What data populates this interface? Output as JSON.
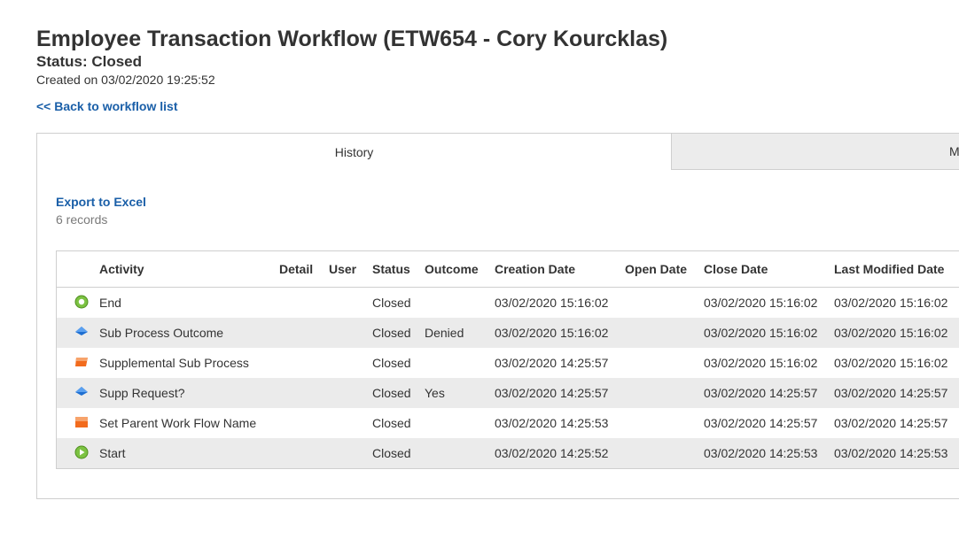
{
  "header": {
    "title": "Employee Transaction Workflow (ETW654 - Cory Kourcklas)",
    "status": "Status: Closed",
    "created": "Created on 03/02/2020 19:25:52",
    "back_link": "<< Back to workflow list"
  },
  "tabs": [
    {
      "label": "History",
      "active": true
    },
    {
      "label": "M",
      "active": false
    }
  ],
  "history": {
    "export_label": "Export to Excel",
    "records_label": "6 records",
    "columns": [
      "Activity",
      "Detail",
      "User",
      "Status",
      "Outcome",
      "Creation Date",
      "Open Date",
      "Close Date",
      "Last Modified Date"
    ],
    "rows": [
      {
        "icon": "end-circle-icon",
        "activity": "End",
        "detail": "",
        "user": "",
        "status": "Closed",
        "outcome": "",
        "creation_date": "03/02/2020 15:16:02",
        "open_date": "",
        "close_date": "03/02/2020 15:16:02",
        "last_modified": "03/02/2020 15:16:02"
      },
      {
        "icon": "decision-diamond-icon",
        "activity": "Sub Process Outcome",
        "detail": "",
        "user": "",
        "status": "Closed",
        "outcome": "Denied",
        "creation_date": "03/02/2020 15:16:02",
        "open_date": "",
        "close_date": "03/02/2020 15:16:02",
        "last_modified": "03/02/2020 15:16:02"
      },
      {
        "icon": "subprocess-icon",
        "activity": "Supplemental Sub Process",
        "detail": "",
        "user": "",
        "status": "Closed",
        "outcome": "",
        "creation_date": "03/02/2020 14:25:57",
        "open_date": "",
        "close_date": "03/02/2020 15:16:02",
        "last_modified": "03/02/2020 15:16:02"
      },
      {
        "icon": "decision-diamond-icon",
        "activity": "Supp Request?",
        "detail": "",
        "user": "",
        "status": "Closed",
        "outcome": "Yes",
        "creation_date": "03/02/2020 14:25:57",
        "open_date": "",
        "close_date": "03/02/2020 14:25:57",
        "last_modified": "03/02/2020 14:25:57"
      },
      {
        "icon": "task-square-icon",
        "activity": "Set Parent Work Flow Name",
        "detail": "",
        "user": "",
        "status": "Closed",
        "outcome": "",
        "creation_date": "03/02/2020 14:25:53",
        "open_date": "",
        "close_date": "03/02/2020 14:25:57",
        "last_modified": "03/02/2020 14:25:57"
      },
      {
        "icon": "start-play-icon",
        "activity": "Start",
        "detail": "",
        "user": "",
        "status": "Closed",
        "outcome": "",
        "creation_date": "03/02/2020 14:25:52",
        "open_date": "",
        "close_date": "03/02/2020 14:25:53",
        "last_modified": "03/02/2020 14:25:53"
      }
    ]
  },
  "colors": {
    "link": "#1a5fa8",
    "row_alt": "#ebebeb",
    "tab_inactive": "#ececec",
    "icon_green": "#7cc242",
    "icon_blue": "#1f6fd1",
    "icon_orange": "#f26b1d"
  }
}
